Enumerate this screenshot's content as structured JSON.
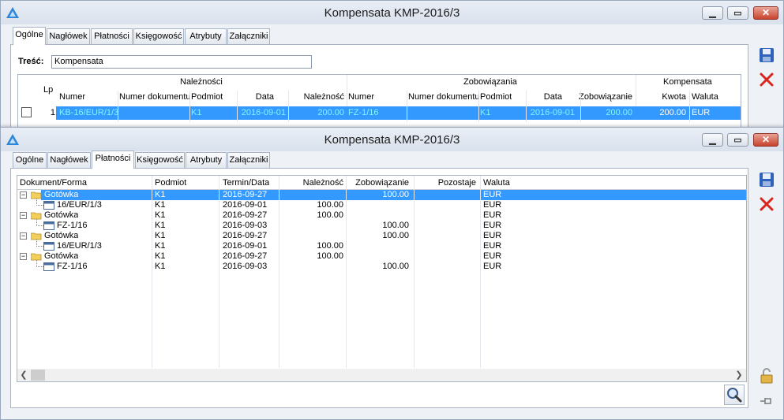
{
  "window1": {
    "title": "Kompensata KMP-2016/3",
    "tabs": [
      "Ogólne",
      "Nagłówek",
      "Płatności",
      "Księgowość",
      "Atrybuty",
      "Załączniki"
    ],
    "active_tab": "Ogólne",
    "tresc_label": "Treść:",
    "tresc_value": "Kompensata",
    "group_headers": {
      "naleznosci": "Należności",
      "zobowiazania": "Zobowiązania",
      "kompensata": "Kompensata"
    },
    "columns": {
      "lp": "Lp",
      "n_numer": "Numer",
      "n_numer_dok": "Numer dokumentu",
      "n_podmiot": "Podmiot",
      "n_data": "Data",
      "n_naleznosc": "Należność",
      "z_numer": "Numer",
      "z_numer_dok": "Numer dokumentu",
      "z_podmiot": "Podmiot",
      "z_data": "Data",
      "z_zobowiazanie": "Zobowiązanie",
      "k_kwota": "Kwota",
      "k_waluta": "Waluta"
    },
    "row": {
      "lp": "1",
      "n_numer": "KB-16/EUR/1/3",
      "n_numer_dok": "",
      "n_podmiot": "K1",
      "n_data": "2016-09-01",
      "n_naleznosc": "200.00",
      "z_numer": "FZ-1/16",
      "z_numer_dok": "",
      "z_podmiot": "K1",
      "z_data": "2016-09-01",
      "z_zobowiazanie": "200.00",
      "k_kwota": "200.00",
      "k_waluta": "EUR"
    }
  },
  "window2": {
    "title": "Kompensata KMP-2016/3",
    "tabs": [
      "Ogólne",
      "Nagłówek",
      "Płatności",
      "Księgowość",
      "Atrybuty",
      "Załączniki"
    ],
    "active_tab": "Płatności",
    "columns": {
      "dokument": "Dokument/Forma",
      "podmiot": "Podmiot",
      "termin": "Termin/Data",
      "naleznosc": "Należność",
      "zobowiazanie": "Zobowiązanie",
      "pozostaje": "Pozostaje",
      "waluta": "Waluta"
    },
    "rows": [
      {
        "type": "folder",
        "label": "Gotówka",
        "podmiot": "K1",
        "termin": "2016-09-27",
        "naleznosc": "",
        "zobowiazanie": "100.00",
        "pozostaje": "",
        "waluta": "EUR",
        "selected": true
      },
      {
        "type": "doc",
        "label": "16/EUR/1/3",
        "podmiot": "K1",
        "termin": "2016-09-01",
        "naleznosc": "100.00",
        "zobowiazanie": "",
        "pozostaje": "",
        "waluta": "EUR"
      },
      {
        "type": "folder",
        "label": "Gotówka",
        "podmiot": "K1",
        "termin": "2016-09-27",
        "naleznosc": "100.00",
        "zobowiazanie": "",
        "pozostaje": "",
        "waluta": "EUR"
      },
      {
        "type": "doc",
        "label": "FZ-1/16",
        "podmiot": "K1",
        "termin": "2016-09-03",
        "naleznosc": "",
        "zobowiazanie": "100.00",
        "pozostaje": "",
        "waluta": "EUR"
      },
      {
        "type": "folder",
        "label": "Gotówka",
        "podmiot": "K1",
        "termin": "2016-09-27",
        "naleznosc": "",
        "zobowiazanie": "100.00",
        "pozostaje": "",
        "waluta": "EUR"
      },
      {
        "type": "doc",
        "label": "16/EUR/1/3",
        "podmiot": "K1",
        "termin": "2016-09-01",
        "naleznosc": "100.00",
        "zobowiazanie": "",
        "pozostaje": "",
        "waluta": "EUR"
      },
      {
        "type": "folder",
        "label": "Gotówka",
        "podmiot": "K1",
        "termin": "2016-09-27",
        "naleznosc": "100.00",
        "zobowiazanie": "",
        "pozostaje": "",
        "waluta": "EUR"
      },
      {
        "type": "doc",
        "label": "FZ-1/16",
        "podmiot": "K1",
        "termin": "2016-09-03",
        "naleznosc": "",
        "zobowiazanie": "100.00",
        "pozostaje": "",
        "waluta": "EUR"
      }
    ]
  },
  "colors": {
    "selection": "#3399ff",
    "selection_text_cyan": "#7ff5ff",
    "border": "#a8b4c6",
    "close_red": "#c8432e"
  },
  "icons": {
    "app": "triangle-logo-icon",
    "save": "floppy-disk-icon",
    "cancel": "red-x-icon",
    "search": "magnifier-icon",
    "lock": "padlock-icon",
    "pin": "pin-icon"
  }
}
